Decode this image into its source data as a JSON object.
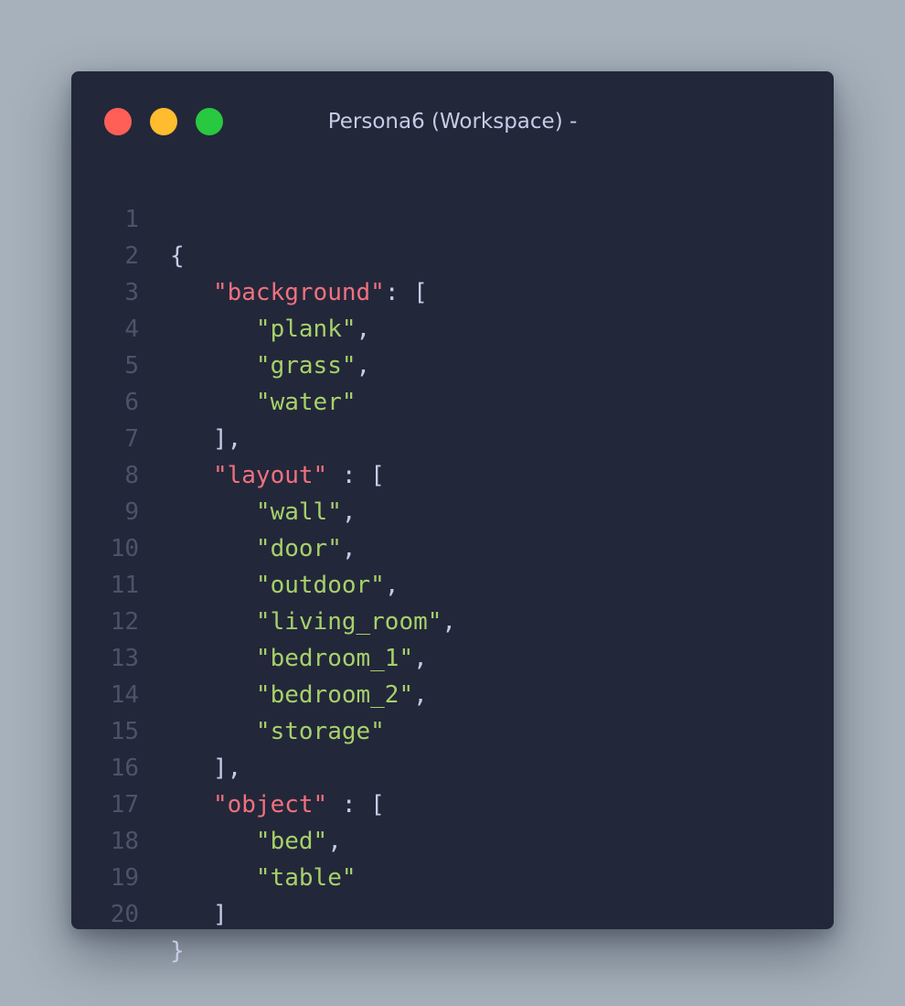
{
  "window": {
    "title": "Persona6 (Workspace) -",
    "controls": {
      "close_color": "#ff5f57",
      "minimize_color": "#febc2e",
      "maximize_color": "#28c840"
    }
  },
  "editor": {
    "line_numbers": [
      "1",
      "2",
      "3",
      "4",
      "5",
      "6",
      "7",
      "8",
      "9",
      "10",
      "11",
      "12",
      "13",
      "14",
      "15",
      "16",
      "17",
      "18",
      "19",
      "20"
    ],
    "lines": {
      "l1": {
        "open": "{"
      },
      "l2": {
        "key": "\"background\"",
        "sep": ": ["
      },
      "l3": {
        "value": "\"plank\"",
        "comma": ","
      },
      "l4": {
        "value": "\"grass\"",
        "comma": ","
      },
      "l5": {
        "value": "\"water\""
      },
      "l6": {
        "close": "],"
      },
      "l7": {
        "key": "\"layout\"",
        "sep": " : ["
      },
      "l8": {
        "value": "\"wall\"",
        "comma": ","
      },
      "l9": {
        "value": "\"door\"",
        "comma": ","
      },
      "l10": {
        "value": "\"outdoor\"",
        "comma": ","
      },
      "l11": {
        "value": "\"living_room\"",
        "comma": ","
      },
      "l12": {
        "value": "\"bedroom_1\"",
        "comma": ","
      },
      "l13": {
        "value": "\"bedroom_2\"",
        "comma": ","
      },
      "l14": {
        "value": "\"storage\""
      },
      "l15": {
        "close": "],"
      },
      "l16": {
        "key": "\"object\"",
        "sep": " : ["
      },
      "l17": {
        "value": "\"bed\"",
        "comma": ","
      },
      "l18": {
        "value": "\"table\""
      },
      "l19": {
        "close": "]"
      },
      "l20": {
        "close": "}"
      }
    },
    "colors": {
      "background": "#23273a",
      "key": "#f0717e",
      "string": "#a6d16a",
      "punctuation": "#c6cbe6",
      "line_number": "#4d5368"
    }
  }
}
